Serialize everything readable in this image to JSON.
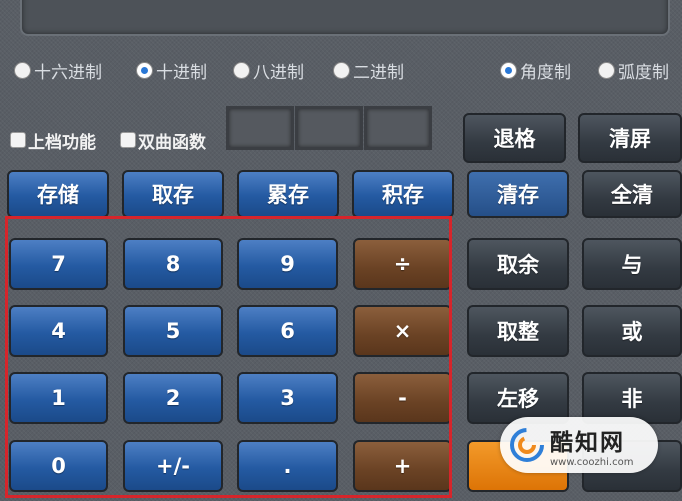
{
  "display": {
    "value": ""
  },
  "base_modes": [
    {
      "label": "十六进制",
      "selected": false
    },
    {
      "label": "十进制",
      "selected": true
    },
    {
      "label": "八进制",
      "selected": false
    },
    {
      "label": "二进制",
      "selected": false
    }
  ],
  "angle_modes": [
    {
      "label": "角度制",
      "selected": true
    },
    {
      "label": "弧度制",
      "selected": false
    }
  ],
  "options": {
    "shift_label": "上档功能",
    "hyperbolic_label": "双曲函数"
  },
  "controls": {
    "backspace": "退格",
    "clear_screen": "清屏"
  },
  "memory": {
    "store": "存储",
    "recall": "取存",
    "add": "累存",
    "multiply": "积存",
    "clear": "清存",
    "all_clear": "全清"
  },
  "keys": {
    "seven": "7",
    "eight": "8",
    "nine": "9",
    "divide": "÷",
    "four": "4",
    "five": "5",
    "six": "6",
    "times": "×",
    "one": "1",
    "two": "2",
    "three": "3",
    "minus": "-",
    "zero": "0",
    "sign": "+/-",
    "dot": ".",
    "plus": "+"
  },
  "logic": {
    "mod": "取余",
    "and": "与",
    "int": "取整",
    "or": "或",
    "shift_left": "左移",
    "not": "非"
  },
  "watermark": {
    "name": "酷知网",
    "url": "www.coozhi.com"
  },
  "colors": {
    "blue_key": "#245aa2",
    "dark_key": "#333a42",
    "operator_key": "#6a4224",
    "highlight": "#d6252b",
    "accent_orange": "#dd7406"
  }
}
